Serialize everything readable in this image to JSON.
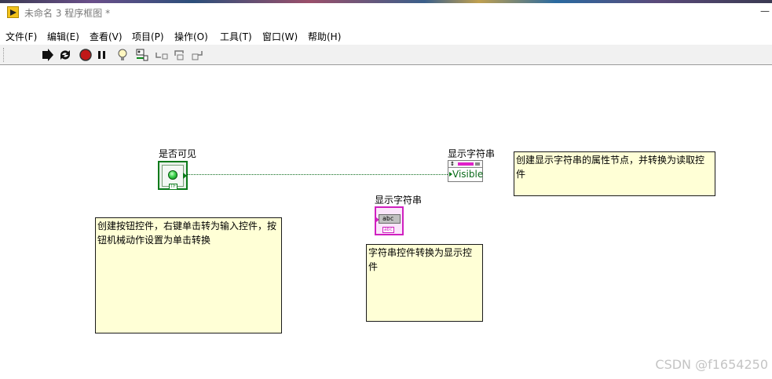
{
  "window": {
    "title": "未命名 3 程序框图 *"
  },
  "menu": [
    "文件(F)",
    "编辑(E)",
    "查看(V)",
    "项目(P)",
    "操作(O)",
    "工具(T)",
    "窗口(W)",
    "帮助(H)"
  ],
  "toolbar": {
    "icons": [
      "run-arrow-icon",
      "run-continuously-icon",
      "abort-icon",
      "pause-icon",
      "highlight-execution-icon",
      "retain-wire-values-icon",
      "step-into-icon",
      "step-over-icon",
      "step-out-icon"
    ]
  },
  "diagram": {
    "bool_control_label": "是否可见",
    "bool_tf_text": "TF",
    "prop_node_label": "显示字符串",
    "prop_node_property": "Visible",
    "string_indicator_label": "显示字符串",
    "string_abc": "abc",
    "string_abc_small": "abc",
    "notes": {
      "button_note": "创建按钮控件，右键单击转为输入控件，按钮机械动作设置为单击转换",
      "string_note": "字符串控件转换为显示控件",
      "property_note": "创建显示字符串的属性节点，并转换为读取控件"
    }
  },
  "colors": {
    "boolean": "#0a7a1a",
    "string": "#d020c0",
    "note_bg": "#ffffd6"
  },
  "watermark": "CSDN @f1654250"
}
